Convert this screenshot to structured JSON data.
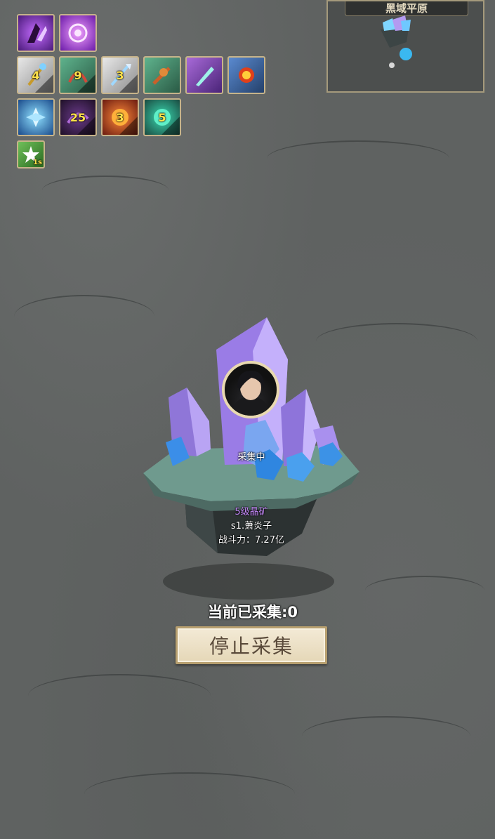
{
  "minimap": {
    "title": "黑域平原"
  },
  "skills": {
    "row1": [
      {
        "icon": "shadow-claw-icon",
        "color": "#8a3fd6"
      },
      {
        "icon": "purple-vortex-icon",
        "color": "#9b3fe0"
      }
    ],
    "row2": [
      {
        "icon": "golden-staff-icon",
        "level": "4",
        "color": "#d8d8d8"
      },
      {
        "icon": "jade-whip-icon",
        "level": "9",
        "color": "#3f8a6a"
      },
      {
        "icon": "silver-spear-icon",
        "level": "3",
        "color": "#d8d8d8"
      },
      {
        "icon": "bronze-weapon-icon",
        "level": "",
        "color": "#3f8a6a"
      },
      {
        "icon": "crystal-sword-icon",
        "level": "",
        "color": "#8a3fd6"
      },
      {
        "icon": "flame-orb-icon",
        "level": "",
        "color": "#3b6fb8"
      }
    ],
    "row3": [
      {
        "icon": "ice-lotus-icon",
        "level": "",
        "color": "#2f7fd0"
      },
      {
        "icon": "dark-swirl-icon",
        "level": "25",
        "color": "#8a2f2f"
      },
      {
        "icon": "fire-core-icon",
        "level": "3",
        "color": "#b83a2a"
      },
      {
        "icon": "green-flame-icon",
        "level": "5",
        "color": "#b83a2a"
      }
    ],
    "buff": {
      "icon": "burst-buff-icon",
      "timer": "1s",
      "color": "#4a9a3a"
    }
  },
  "mine": {
    "status": "采集中",
    "name": "5级晶矿",
    "owner": "s1.萧炎子",
    "power": "战斗力：7.27亿"
  },
  "gather": {
    "count_text": "当前已采集:0",
    "stop_label": "停止采集"
  }
}
